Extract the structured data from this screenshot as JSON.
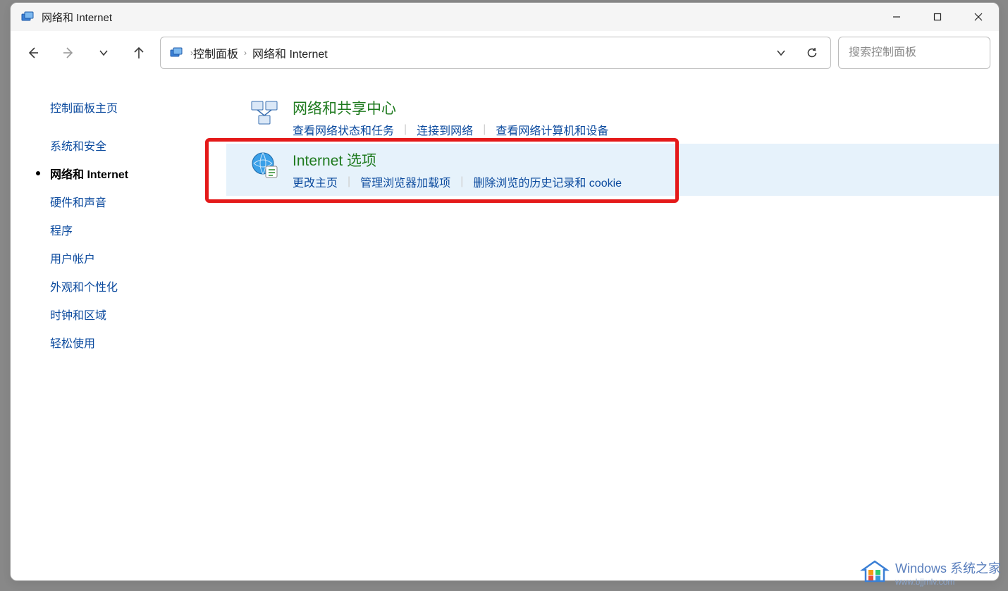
{
  "window": {
    "title": "网络和 Internet"
  },
  "breadcrumbs": {
    "items": [
      "控制面板",
      "网络和 Internet"
    ]
  },
  "search": {
    "placeholder": "搜索控制面板"
  },
  "sidebar": {
    "items": [
      {
        "label": "控制面板主页",
        "active": false,
        "spacer_after": true
      },
      {
        "label": "系统和安全",
        "active": false
      },
      {
        "label": "网络和 Internet",
        "active": true
      },
      {
        "label": "硬件和声音",
        "active": false
      },
      {
        "label": "程序",
        "active": false
      },
      {
        "label": "用户帐户",
        "active": false
      },
      {
        "label": "外观和个性化",
        "active": false
      },
      {
        "label": "时钟和区域",
        "active": false
      },
      {
        "label": "轻松使用",
        "active": false
      }
    ]
  },
  "main": {
    "categories": [
      {
        "title": "网络和共享中心",
        "links": [
          "查看网络状态和任务",
          "连接到网络",
          "查看网络计算机和设备"
        ],
        "highlighted": false
      },
      {
        "title": "Internet 选项",
        "links": [
          "更改主页",
          "管理浏览器加载项",
          "删除浏览的历史记录和 cookie"
        ],
        "highlighted": true
      }
    ]
  },
  "watermark": {
    "text": "Windows 系统之家",
    "sub": "www.bjjmlv.com"
  }
}
